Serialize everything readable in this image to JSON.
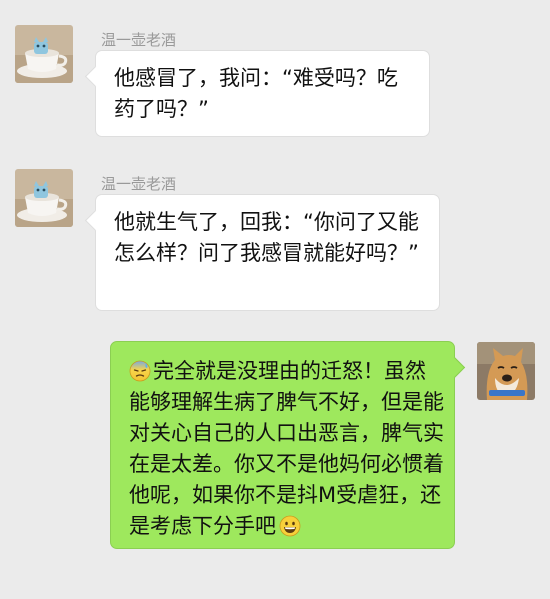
{
  "chat": {
    "messages": [
      {
        "sender": "温一壶老酒",
        "text": "他感冒了，我问：“难受吗？吃药了吗？”",
        "direction": "incoming",
        "avatar_icon": "teacup-avatar"
      },
      {
        "sender": "温一壶老酒",
        "text": "他就生气了，回我：“你问了又能怎么样？问了我感冒就能好吗？”",
        "direction": "incoming",
        "avatar_icon": "teacup-avatar"
      },
      {
        "text": "完全就是没理由的迁怒！虽然能够理解生病了脾气不好，但是能对关心自己的人口出恶言，脾气实在是太差。你又不是他妈何必惯着他呢，如果你不是抖M受虐狂，还是考虑下分手吧",
        "direction": "outgoing",
        "leading_emoji": "sweat-face-emoji",
        "trailing_emoji": "grinning-face-emoji",
        "avatar_icon": "shiba-dog-avatar"
      }
    ]
  },
  "colors": {
    "background": "#ebebeb",
    "incoming_bubble": "#ffffff",
    "outgoing_bubble": "#9ee85d",
    "sender_name": "#9a9a9a"
  }
}
